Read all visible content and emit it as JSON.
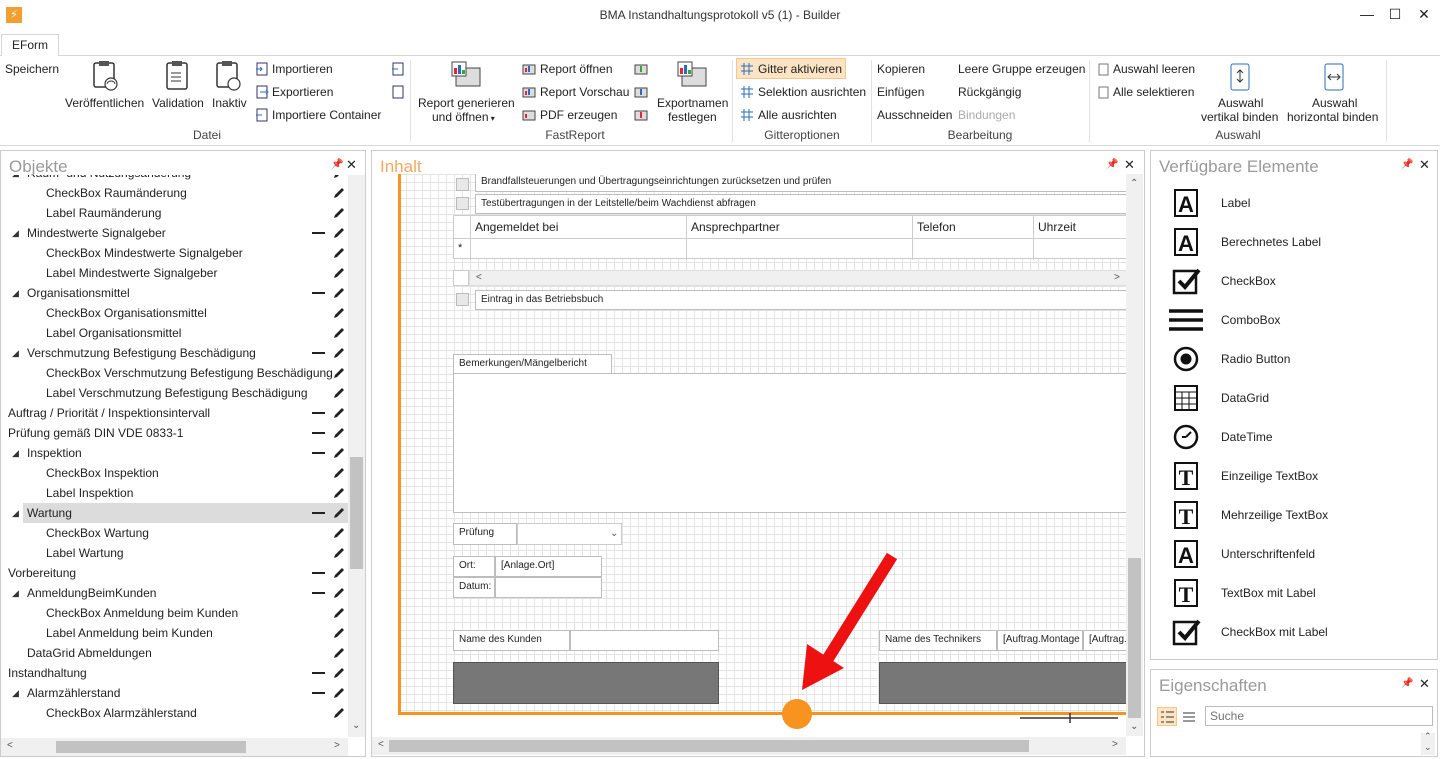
{
  "window": {
    "title": "BMA Instandhaltungsprotokoll v5 (1) - Builder",
    "minimize": "—",
    "maximize": "☐",
    "close": "✕"
  },
  "tab": "EForm",
  "ribbon": {
    "datei": {
      "speichern": "Speichern",
      "veroeffentlichen": "Veröffentlichen",
      "validation": "Validation",
      "inaktiv": "Inaktiv",
      "importieren": "Importieren",
      "exportieren": "Exportieren",
      "importiere_container": "Importiere Container",
      "group": "Datei"
    },
    "fastreport": {
      "report_generieren": "Report generieren",
      "und_oeffnen": "und öffnen",
      "report_oeffnen": "Report öffnen",
      "report_vorschau": "Report Vorschau",
      "pdf_erzeugen": "PDF erzeugen",
      "exportnamen": "Exportnamen",
      "festlegen": "festlegen",
      "group": "FastReport"
    },
    "gitter": {
      "aktivieren": "Gitter aktivieren",
      "selektion_ausrichten": "Selektion ausrichten",
      "alle_ausrichten": "Alle ausrichten",
      "group": "Gitteroptionen"
    },
    "bearbeitung": {
      "kopieren": "Kopieren",
      "einfuegen": "Einfügen",
      "ausschneiden": "Ausschneiden",
      "leere_gruppe": "Leere Gruppe erzeugen",
      "rueckgaengig": "Rückgängig",
      "bindungen": "Bindungen",
      "group": "Bearbeitung"
    },
    "auswahl": {
      "leeren": "Auswahl leeren",
      "alle_selektieren": "Alle selektieren",
      "vertikal_1": "Auswahl",
      "vertikal_2": "vertikal binden",
      "horizontal_1": "Auswahl",
      "horizontal_2": "horizontal binden",
      "group": "Auswahl"
    }
  },
  "objekte": {
    "title": "Objekte",
    "rows": [
      {
        "label": "Raum- und Nutzungsänderung",
        "indent": 1,
        "tri": true,
        "dash": true
      },
      {
        "label": "CheckBox Raumänderung",
        "indent": 2,
        "tri": false,
        "dash": false
      },
      {
        "label": "Label Raumänderung",
        "indent": 2,
        "tri": false,
        "dash": false
      },
      {
        "label": "Mindestwerte Signalgeber",
        "indent": 1,
        "tri": true,
        "dash": true
      },
      {
        "label": "CheckBox Mindestwerte Signalgeber",
        "indent": 2,
        "tri": false,
        "dash": false
      },
      {
        "label": "Label Mindestwerte Signalgeber",
        "indent": 2,
        "tri": false,
        "dash": false
      },
      {
        "label": "Organisationsmittel",
        "indent": 1,
        "tri": true,
        "dash": true
      },
      {
        "label": "CheckBox Organisationsmittel",
        "indent": 2,
        "tri": false,
        "dash": false
      },
      {
        "label": "Label Organisationsmittel",
        "indent": 2,
        "tri": false,
        "dash": false
      },
      {
        "label": "Verschmutzung Befestigung Beschädigung",
        "indent": 1,
        "tri": true,
        "dash": true
      },
      {
        "label": "CheckBox Verschmutzung Befestigung Beschädigung",
        "indent": 2,
        "tri": false,
        "dash": false
      },
      {
        "label": "Label Verschmutzung Befestigung Beschädigung",
        "indent": 2,
        "tri": false,
        "dash": false
      },
      {
        "label": "Auftrag / Priorität / Inspektionsintervall",
        "indent": 0,
        "tri": false,
        "dash": true
      },
      {
        "label": "Prüfung gemäß DIN VDE 0833-1",
        "indent": 0,
        "tri": false,
        "dash": true
      },
      {
        "label": "Inspektion",
        "indent": 1,
        "tri": true,
        "dash": true
      },
      {
        "label": "CheckBox Inspektion",
        "indent": 2,
        "tri": false,
        "dash": false
      },
      {
        "label": "Label Inspektion",
        "indent": 2,
        "tri": false,
        "dash": false
      },
      {
        "label": "Wartung",
        "indent": 1,
        "tri": true,
        "dash": true,
        "selected": true
      },
      {
        "label": "CheckBox Wartung",
        "indent": 2,
        "tri": false,
        "dash": false
      },
      {
        "label": "Label Wartung",
        "indent": 2,
        "tri": false,
        "dash": false
      },
      {
        "label": "Vorbereitung",
        "indent": 0,
        "tri": false,
        "dash": true
      },
      {
        "label": "AnmeldungBeimKunden",
        "indent": 1,
        "tri": true,
        "dash": true
      },
      {
        "label": "CheckBox Anmeldung beim Kunden",
        "indent": 2,
        "tri": false,
        "dash": false
      },
      {
        "label": "Label Anmeldung beim Kunden",
        "indent": 2,
        "tri": false,
        "dash": false
      },
      {
        "label": "DataGrid Abmeldungen",
        "indent": 1,
        "tri": false,
        "dash": false
      },
      {
        "label": "Instandhaltung",
        "indent": 0,
        "tri": false,
        "dash": true
      },
      {
        "label": "Alarmzählerstand",
        "indent": 1,
        "tri": true,
        "dash": true
      },
      {
        "label": "CheckBox Alarmzählerstand",
        "indent": 2,
        "tri": false,
        "dash": false
      }
    ]
  },
  "inhalt": {
    "title": "Inhalt",
    "row1": "Brandfallsteuerungen und Übertragungseinrichtungen zurücksetzen und prüfen",
    "row2": "Testübertragungen in der Leitstelle/beim Wachdienst abfragen",
    "grid_cols": [
      "Angemeldet bei",
      "Ansprechpartner",
      "Telefon",
      "Uhrzeit"
    ],
    "grid_star": "*",
    "grid_scroll_left": "<",
    "grid_scroll_right": ">",
    "row3": "Eintrag in das Betriebsbuch",
    "bemerkungen": "Bemerkungen/Mängelbericht",
    "pruefung": "Prüfung",
    "ort": "Ort:",
    "ort_value": "[Anlage.Ort]",
    "datum": "Datum:",
    "kunde": "Name des Kunden",
    "techniker": "Name des Technikers",
    "tech_value1": "[Auftrag.Montage",
    "tech_value2": "[Auftrag."
  },
  "elemente": {
    "title": "Verfügbare Elemente",
    "items": [
      {
        "label": "Label",
        "icon": "label-icon"
      },
      {
        "label": "Berechnetes Label",
        "icon": "computed-label-icon"
      },
      {
        "label": "CheckBox",
        "icon": "checkbox-icon"
      },
      {
        "label": "ComboBox",
        "icon": "combobox-icon"
      },
      {
        "label": "Radio Button",
        "icon": "radio-button-icon"
      },
      {
        "label": "DataGrid",
        "icon": "datagrid-icon"
      },
      {
        "label": "DateTime",
        "icon": "datetime-icon"
      },
      {
        "label": "Einzeilige TextBox",
        "icon": "single-line-textbox-icon"
      },
      {
        "label": "Mehrzeilige TextBox",
        "icon": "multi-line-textbox-icon"
      },
      {
        "label": "Unterschriftenfeld",
        "icon": "signature-field-icon"
      },
      {
        "label": "TextBox mit Label",
        "icon": "textbox-with-label-icon"
      },
      {
        "label": "CheckBox mit Label",
        "icon": "checkbox-with-label-icon"
      }
    ]
  },
  "eigenschaften": {
    "title": "Eigenschaften",
    "search_placeholder": "Suche"
  },
  "colors": {
    "accent_orange": "#f7931e",
    "arrow_red": "#ee1111",
    "panel_title_gray": "#9a9a9a",
    "field_dark": "#777777"
  }
}
